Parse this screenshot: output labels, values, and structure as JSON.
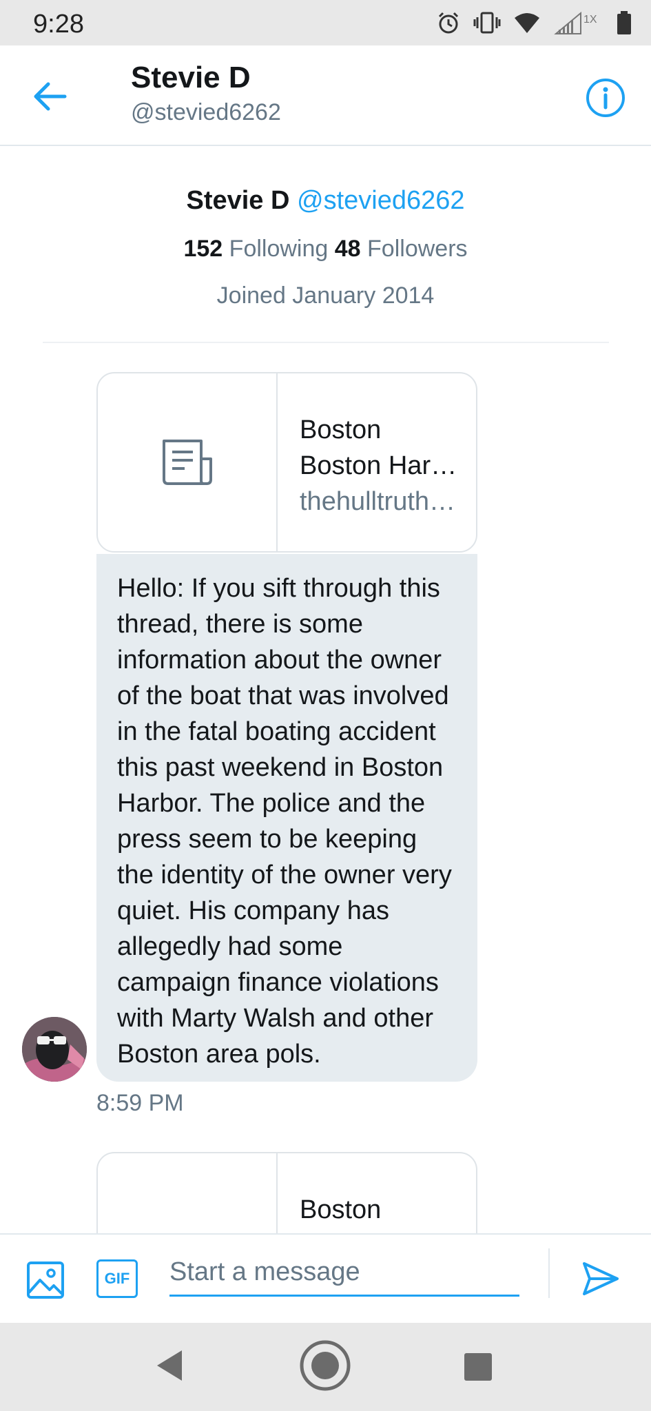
{
  "status_bar": {
    "time": "9:28",
    "signal_label": "1X"
  },
  "header": {
    "title": "Stevie D",
    "handle": "@stevied6262"
  },
  "profile": {
    "name": "Stevie D",
    "handle": "@stevied6262",
    "following_count": "152",
    "following_label": "Following",
    "followers_count": "48",
    "followers_label": "Followers",
    "joined": "Joined January 2014"
  },
  "messages": [
    {
      "card_title": "Boston Harbor Boa…",
      "card_url": "thehulltruth…",
      "text": "Hello:  If you sift through this thread, there is some information about the owner of the boat that was involved in the fatal boating accident this past weekend in Boston Harbor.  The police and the press seem to be keeping the identity of the owner very quiet.  His company has allegedly had some campaign finance violations with Marty Walsh and other Boston area pols.",
      "time": "8:59 PM"
    },
    {
      "card_title": "Boston"
    }
  ],
  "composer": {
    "placeholder": "Start a message",
    "gif_label": "GIF"
  },
  "colors": {
    "accent": "#1da1f2",
    "secondary_text": "#657786",
    "bubble": "#e6ecf0"
  },
  "icons": [
    "back-arrow-icon",
    "info-icon",
    "document-icon",
    "image-icon",
    "gif-icon",
    "send-icon",
    "alarm-icon",
    "vibrate-icon",
    "wifi-icon",
    "signal-icon",
    "battery-icon"
  ]
}
